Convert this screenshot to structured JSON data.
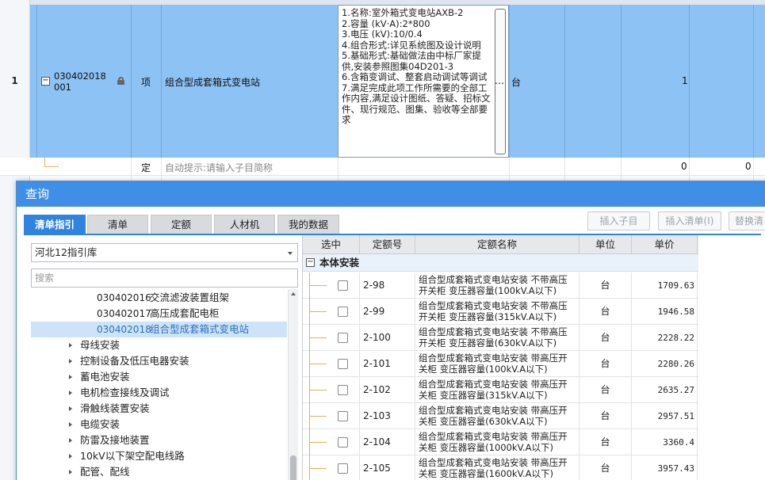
{
  "background": {
    "row1": {
      "row_number": "1",
      "code": "030402018001",
      "type": "项",
      "name": "组合型成套箱式变电站",
      "description": "1.名称:室外箱式变电站AXB-2\n2.容量 (kV·A):2*800\n3.电压 (kV):10/0.4\n4.组合形式:详见系统图及设计说明\n5.基础形式:基础做法由中标厂家提供,安装参照图集04D201-3\n6.含箱变调试、整套启动调试等调试\n7.满足完成此项工作所需要的全部工作内容,满足设计图纸、答疑、招标文件、现行规范、图集、验收等全部要求",
      "ellipsis": "…",
      "unit": "台",
      "quantity": "1"
    },
    "row2": {
      "type": "定",
      "hint": "自动提示:请输入子目简称",
      "value1": "0",
      "value2": "0"
    }
  },
  "dialog": {
    "title": "查询",
    "tabs": [
      {
        "label": "清单指引",
        "active": true
      },
      {
        "label": "清单",
        "active": false
      },
      {
        "label": "定额",
        "active": false
      },
      {
        "label": "人材机",
        "active": false
      },
      {
        "label": "我的数据",
        "active": false
      }
    ],
    "buttons": {
      "insert_sub": "插入子目",
      "insert_list": "插入清单(I)",
      "replace": "替换清"
    },
    "library_select": "河北12指引库",
    "search_placeholder": "搜索",
    "tree": [
      {
        "code": "030402016",
        "name": "交流滤波装置组架",
        "selected": false
      },
      {
        "code": "030402017",
        "name": "高压成套配电柜",
        "selected": false
      },
      {
        "code": "030402018",
        "name": "组合型成套箱式变电站",
        "selected": true
      }
    ],
    "tree_groups": [
      "母线安装",
      "控制设备及低压电器安装",
      "蓄电池安装",
      "电机检查接线及调试",
      "滑触线装置安装",
      "电缆安装",
      "防雷及接地装置",
      "10kV以下架空配电线路",
      "配管、配线"
    ],
    "table": {
      "headers": {
        "select": "选中",
        "code": "定额号",
        "name": "定额名称",
        "unit": "单位",
        "price": "单价"
      },
      "group_label": "本体安装",
      "rows": [
        {
          "code": "2-98",
          "name": "组合型成套箱式变电站安装 不带高压开关柜 变压器容量(100kV.A以下)",
          "unit": "台",
          "price": "1709.63"
        },
        {
          "code": "2-99",
          "name": "组合型成套箱式变电站安装 不带高压开关柜 变压器容量(315kV.A以下)",
          "unit": "台",
          "price": "1946.58"
        },
        {
          "code": "2-100",
          "name": "组合型成套箱式变电站安装 不带高压开关柜 变压器容量(630kV.A以下)",
          "unit": "台",
          "price": "2228.22"
        },
        {
          "code": "2-101",
          "name": "组合型成套箱式变电站安装 带高压开关柜 变压器容量(100kV.A以下)",
          "unit": "台",
          "price": "2280.26"
        },
        {
          "code": "2-102",
          "name": "组合型成套箱式变电站安装 带高压开关柜 变压器容量(315kV.A以下)",
          "unit": "台",
          "price": "2635.27"
        },
        {
          "code": "2-103",
          "name": "组合型成套箱式变电站安装 带高压开关柜 变压器容量(630kV.A以下)",
          "unit": "台",
          "price": "2957.51"
        },
        {
          "code": "2-104",
          "name": "组合型成套箱式变电站安装 带高压开关柜 变压器容量(1000kV.A以下)",
          "unit": "台",
          "price": "3360.4"
        },
        {
          "code": "2-105",
          "name": "组合型成套箱式变电站安装 带高压开关柜 变压器容量(1600kV.A以下)",
          "unit": "台",
          "price": "3957.43"
        }
      ]
    }
  }
}
